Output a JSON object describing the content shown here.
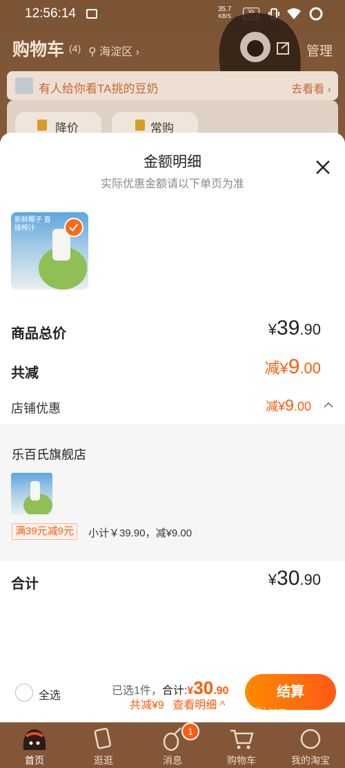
{
  "status_bar": {
    "time": "12:56:14",
    "speed_value": "35.7",
    "speed_unit": "KB/S",
    "volte": "Vo LTE 2"
  },
  "header": {
    "title": "购物车",
    "count": "(4)",
    "location": "海淀区",
    "manage": "管理"
  },
  "promo_banner": {
    "text": "有人给你看TA挑的豆奶",
    "link": "去看看"
  },
  "filter_chips": [
    {
      "label": "降价"
    },
    {
      "label": "常购"
    }
  ],
  "sheet": {
    "title": "金额明细",
    "subtitle": "实际优惠金额请以下单页为准",
    "product_image_text": "新鲜椰子 直接榨汁",
    "total": {
      "label": "商品总价",
      "yen": "¥",
      "int": "39",
      "dec": ".90"
    },
    "reduce": {
      "label": "共减",
      "prefix": "减¥",
      "int": "9",
      "dec": ".00"
    },
    "store_discount": {
      "label": "店铺优惠",
      "prefix": "减¥",
      "int": "9",
      "dec": ".00"
    },
    "store": {
      "name": "乐百氏旗舰店",
      "tag": "满39元减9元",
      "subtotal": "小计￥39.90，减¥9.00"
    },
    "sum": {
      "label": "合计",
      "yen": "¥",
      "int": "30",
      "dec": ".90"
    }
  },
  "bottom_bar": {
    "select_all": "全选",
    "selected_info": "已选1件，",
    "total_label": "合计:",
    "total_yen": "¥",
    "total_int": "30",
    "total_dec": ".90",
    "saving_text": "共减¥9",
    "detail_link": "查看明细",
    "checkout": "结算"
  },
  "tabbar": {
    "items": [
      {
        "label": "首页"
      },
      {
        "label": "逛逛"
      },
      {
        "label": "消息"
      },
      {
        "label": "购物车"
      },
      {
        "label": "我的淘宝"
      }
    ],
    "message_badge": "1",
    "watermark": "zhizhibi.com"
  },
  "colors": {
    "accent": "#ff5a0a",
    "tabbar_bg": "#835638",
    "header_bg": "#7b5434"
  }
}
